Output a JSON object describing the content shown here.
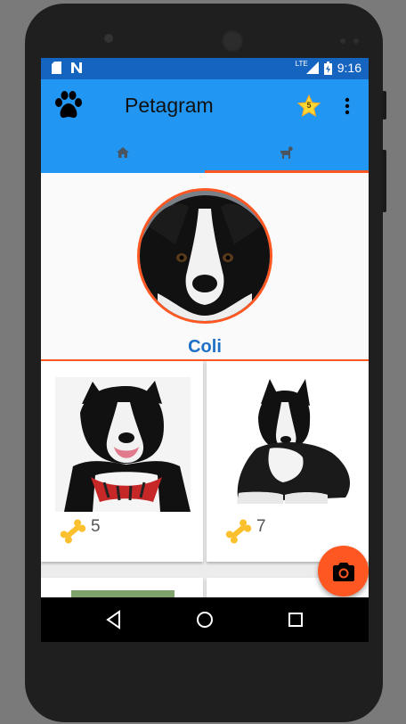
{
  "status_bar": {
    "time": "9:16",
    "network": "LTE"
  },
  "app_bar": {
    "title": "Petagram",
    "favorites_count": "5"
  },
  "tabs": [
    {
      "icon": "home-icon"
    },
    {
      "icon": "dog-icon"
    }
  ],
  "profile": {
    "name": "Coli"
  },
  "posts": [
    {
      "likes": "5"
    },
    {
      "likes": "7"
    }
  ],
  "colors": {
    "primary": "#2196f3",
    "primary_dark": "#1565c0",
    "accent": "#ff5722",
    "name_text": "#1e6fc6"
  }
}
